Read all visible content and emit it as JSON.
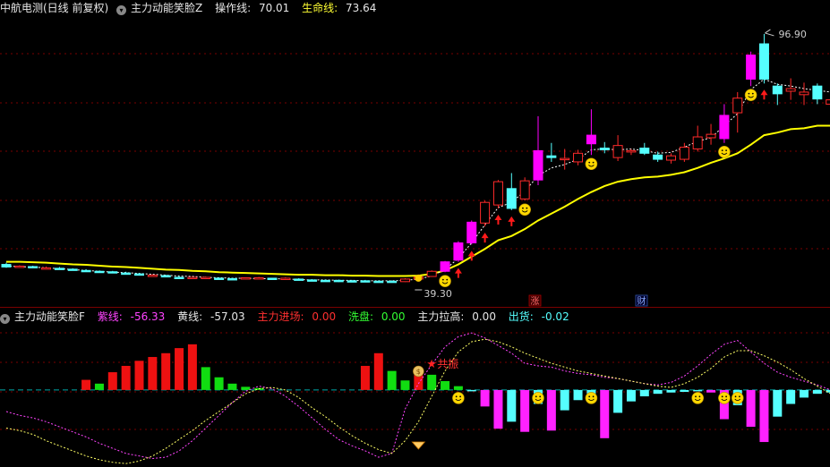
{
  "main_legend": {
    "stock": "中航电测(日线 前复权)",
    "indicator": "主力动能笑脸Z",
    "op_label": "操作线:",
    "op_value": "70.01",
    "life_label": "生命线:",
    "life_value": "73.64"
  },
  "sub_legend": {
    "indicator": "主力动能笑脸F",
    "purple_label": "紫线:",
    "purple_value": "-56.33",
    "yellow_label": "黄线:",
    "yellow_value": "-57.03",
    "inflow_label": "主力进场:",
    "inflow_value": "0.00",
    "wash_label": "洗盘:",
    "wash_value": "0.00",
    "lift_label": "主力拉高:",
    "lift_value": "0.00",
    "out_label": "出货:",
    "out_value": "-0.02"
  },
  "annotations": {
    "high_price": "96.90",
    "low_price": "39.30",
    "tag_rise": "涨",
    "tag_fin": "财",
    "resonance": "共振"
  },
  "colors": {
    "up": "#ff2a2a",
    "down": "#55ffff",
    "limit_up": "#ff00ff",
    "life_line": "#ffff00",
    "op_line": "#ffffff",
    "purple_line": "#ff44ff",
    "yellow_line": "#ffff66"
  },
  "chart_data": [
    {
      "type": "candlestick",
      "title": "中航电测(日线 前复权)",
      "ylim": [
        35,
        100
      ],
      "candles": [
        {
          "o": 43.4,
          "h": 43.8,
          "l": 42.6,
          "c": 42.8,
          "k": "down"
        },
        {
          "o": 43.0,
          "h": 43.2,
          "l": 42.7,
          "c": 43.0,
          "k": "up"
        },
        {
          "o": 42.9,
          "h": 43.1,
          "l": 42.5,
          "c": 42.7,
          "k": "down"
        },
        {
          "o": 42.6,
          "h": 42.9,
          "l": 42.4,
          "c": 42.6,
          "k": "up"
        },
        {
          "o": 42.5,
          "h": 42.8,
          "l": 42.2,
          "c": 42.3,
          "k": "down"
        },
        {
          "o": 42.3,
          "h": 42.5,
          "l": 42.0,
          "c": 42.2,
          "k": "down"
        },
        {
          "o": 42.0,
          "h": 42.3,
          "l": 41.8,
          "c": 41.9,
          "k": "down"
        },
        {
          "o": 41.8,
          "h": 42.0,
          "l": 41.5,
          "c": 41.6,
          "k": "down"
        },
        {
          "o": 41.7,
          "h": 41.9,
          "l": 41.4,
          "c": 41.5,
          "k": "down"
        },
        {
          "o": 41.4,
          "h": 41.7,
          "l": 41.1,
          "c": 41.2,
          "k": "down"
        },
        {
          "o": 41.2,
          "h": 41.4,
          "l": 40.9,
          "c": 41.0,
          "k": "down"
        },
        {
          "o": 40.9,
          "h": 41.1,
          "l": 40.6,
          "c": 40.8,
          "k": "up"
        },
        {
          "o": 40.8,
          "h": 41.0,
          "l": 40.4,
          "c": 40.5,
          "k": "down"
        },
        {
          "o": 40.4,
          "h": 40.7,
          "l": 40.2,
          "c": 40.3,
          "k": "down"
        },
        {
          "o": 40.3,
          "h": 40.6,
          "l": 40.1,
          "c": 40.4,
          "k": "up"
        },
        {
          "o": 40.4,
          "h": 40.6,
          "l": 40.0,
          "c": 40.2,
          "k": "up"
        },
        {
          "o": 40.2,
          "h": 40.4,
          "l": 39.9,
          "c": 40.0,
          "k": "down"
        },
        {
          "o": 40.0,
          "h": 40.3,
          "l": 39.8,
          "c": 40.1,
          "k": "down"
        },
        {
          "o": 40.1,
          "h": 40.4,
          "l": 39.9,
          "c": 40.3,
          "k": "up"
        },
        {
          "o": 40.3,
          "h": 40.5,
          "l": 40.0,
          "c": 40.1,
          "k": "up"
        },
        {
          "o": 40.1,
          "h": 40.3,
          "l": 39.9,
          "c": 40.2,
          "k": "down"
        },
        {
          "o": 40.2,
          "h": 40.4,
          "l": 39.8,
          "c": 40.0,
          "k": "up"
        },
        {
          "o": 40.0,
          "h": 40.2,
          "l": 39.7,
          "c": 39.8,
          "k": "down"
        },
        {
          "o": 39.8,
          "h": 40.0,
          "l": 39.5,
          "c": 39.6,
          "k": "down"
        },
        {
          "o": 39.6,
          "h": 39.9,
          "l": 39.4,
          "c": 39.7,
          "k": "down"
        },
        {
          "o": 39.7,
          "h": 39.9,
          "l": 39.3,
          "c": 39.5,
          "k": "down"
        },
        {
          "o": 39.5,
          "h": 39.8,
          "l": 39.3,
          "c": 39.6,
          "k": "down"
        },
        {
          "o": 39.6,
          "h": 39.8,
          "l": 39.3,
          "c": 39.4,
          "k": "down"
        },
        {
          "o": 39.4,
          "h": 39.7,
          "l": 39.3,
          "c": 39.5,
          "k": "down"
        },
        {
          "o": 39.5,
          "h": 39.7,
          "l": 39.3,
          "c": 39.4,
          "k": "down"
        },
        {
          "o": 39.4,
          "h": 40.2,
          "l": 39.3,
          "c": 40.0,
          "k": "up"
        },
        {
          "o": 40.0,
          "h": 40.6,
          "l": 39.8,
          "c": 40.5,
          "k": "up"
        },
        {
          "o": 40.6,
          "h": 42.0,
          "l": 40.5,
          "c": 41.8,
          "k": "up"
        },
        {
          "o": 41.8,
          "h": 44.2,
          "l": 41.6,
          "c": 44.0,
          "k": "limit"
        },
        {
          "o": 44.4,
          "h": 48.8,
          "l": 44.0,
          "c": 48.4,
          "k": "limit"
        },
        {
          "o": 48.4,
          "h": 53.6,
          "l": 48.0,
          "c": 53.2,
          "k": "limit"
        },
        {
          "o": 53.0,
          "h": 58.2,
          "l": 52.2,
          "c": 57.8,
          "k": "up"
        },
        {
          "o": 57.2,
          "h": 63.0,
          "l": 56.4,
          "c": 62.6,
          "k": "up"
        },
        {
          "o": 61.0,
          "h": 64.6,
          "l": 56.0,
          "c": 56.4,
          "k": "down"
        },
        {
          "o": 58.6,
          "h": 63.6,
          "l": 58.2,
          "c": 62.8,
          "k": "up"
        },
        {
          "o": 63.0,
          "h": 77.8,
          "l": 61.8,
          "c": 69.8,
          "k": "limit"
        },
        {
          "o": 68.6,
          "h": 71.6,
          "l": 67.2,
          "c": 68.2,
          "k": "down"
        },
        {
          "o": 68.0,
          "h": 70.2,
          "l": 65.4,
          "c": 67.8,
          "k": "up"
        },
        {
          "o": 67.2,
          "h": 70.0,
          "l": 66.4,
          "c": 69.2,
          "k": "up"
        },
        {
          "o": 71.4,
          "h": 79.4,
          "l": 68.8,
          "c": 73.4,
          "k": "limit"
        },
        {
          "o": 70.4,
          "h": 71.8,
          "l": 69.2,
          "c": 70.0,
          "k": "down"
        },
        {
          "o": 71.0,
          "h": 73.4,
          "l": 67.4,
          "c": 68.2,
          "k": "up"
        },
        {
          "o": 69.6,
          "h": 70.2,
          "l": 68.8,
          "c": 69.8,
          "k": "up"
        },
        {
          "o": 70.4,
          "h": 71.6,
          "l": 68.8,
          "c": 69.2,
          "k": "down"
        },
        {
          "o": 68.8,
          "h": 69.6,
          "l": 67.2,
          "c": 67.8,
          "k": "down"
        },
        {
          "o": 67.6,
          "h": 69.2,
          "l": 66.8,
          "c": 68.6,
          "k": "up"
        },
        {
          "o": 67.8,
          "h": 71.6,
          "l": 67.2,
          "c": 70.6,
          "k": "up"
        },
        {
          "o": 70.2,
          "h": 75.6,
          "l": 69.6,
          "c": 73.0,
          "k": "up"
        },
        {
          "o": 72.8,
          "h": 76.0,
          "l": 71.2,
          "c": 73.6,
          "k": "up"
        },
        {
          "o": 72.6,
          "h": 80.6,
          "l": 71.6,
          "c": 78.0,
          "k": "limit"
        },
        {
          "o": 78.6,
          "h": 83.4,
          "l": 74.0,
          "c": 82.0,
          "k": "up"
        },
        {
          "o": 86.4,
          "h": 92.8,
          "l": 84.8,
          "c": 92.0,
          "k": "limit"
        },
        {
          "o": 94.6,
          "h": 96.9,
          "l": 85.4,
          "c": 86.4,
          "k": "down"
        },
        {
          "o": 84.8,
          "h": 85.4,
          "l": 80.4,
          "c": 83.0,
          "k": "down"
        },
        {
          "o": 83.6,
          "h": 86.6,
          "l": 81.6,
          "c": 84.2,
          "k": "up"
        },
        {
          "o": 83.4,
          "h": 85.6,
          "l": 80.4,
          "c": 82.8,
          "k": "up"
        },
        {
          "o": 84.8,
          "h": 85.4,
          "l": 80.6,
          "c": 81.8,
          "k": "down"
        },
        {
          "o": 81.6,
          "h": 83.6,
          "l": 78.6,
          "c": 80.6,
          "k": "up"
        }
      ],
      "life_line": [
        44.0,
        44.0,
        43.9,
        43.8,
        43.6,
        43.4,
        43.3,
        43.1,
        42.9,
        42.8,
        42.6,
        42.4,
        42.2,
        42.1,
        41.9,
        41.8,
        41.6,
        41.5,
        41.4,
        41.3,
        41.2,
        41.1,
        41.0,
        41.0,
        40.9,
        40.9,
        40.8,
        40.8,
        40.7,
        40.7,
        40.7,
        40.8,
        41.2,
        42.0,
        43.4,
        45.2,
        47.0,
        49.0,
        50.0,
        51.6,
        53.6,
        55.2,
        56.8,
        58.6,
        60.2,
        61.6,
        62.6,
        63.2,
        63.6,
        63.8,
        64.2,
        64.8,
        65.8,
        67.0,
        68.0,
        69.2,
        71.2,
        73.4,
        74.0,
        74.8,
        75.0,
        75.6,
        75.6
      ],
      "op_line": [
        43.0,
        42.9,
        42.8,
        42.6,
        42.4,
        42.2,
        42.0,
        41.8,
        41.6,
        41.5,
        41.3,
        41.1,
        40.9,
        40.7,
        40.6,
        40.4,
        40.3,
        40.2,
        40.2,
        40.1,
        40.1,
        40.0,
        39.9,
        39.8,
        39.8,
        39.7,
        39.7,
        39.6,
        39.6,
        39.6,
        39.7,
        40.0,
        40.7,
        42.2,
        44.8,
        48.4,
        52.6,
        56.6,
        57.8,
        60.4,
        64.0,
        65.8,
        66.6,
        67.8,
        70.0,
        70.2,
        70.0,
        70.2,
        69.8,
        69.2,
        69.4,
        70.6,
        72.0,
        72.8,
        75.6,
        78.4,
        84.0,
        86.4,
        85.2,
        84.8,
        84.2,
        83.8,
        83.4
      ],
      "marks": {
        "up_arrows": [
          34,
          35,
          36,
          37,
          38,
          57
        ],
        "smileys": [
          33,
          39,
          44,
          54,
          56
        ],
        "money_bag": 31
      },
      "annotations": [
        "96.90",
        "39.30",
        "涨",
        "财"
      ]
    },
    {
      "type": "bar_and_line",
      "title": "主力动能笑脸F",
      "ylim": [
        -120,
        100
      ],
      "hist": [
        {
          "i": 6,
          "v": 16,
          "c": "r"
        },
        {
          "i": 7,
          "v": 10,
          "c": "g"
        },
        {
          "i": 8,
          "v": 28,
          "c": "r"
        },
        {
          "i": 9,
          "v": 38,
          "c": "r"
        },
        {
          "i": 10,
          "v": 46,
          "c": "r"
        },
        {
          "i": 11,
          "v": 52,
          "c": "r"
        },
        {
          "i": 12,
          "v": 58,
          "c": "r"
        },
        {
          "i": 13,
          "v": 66,
          "c": "r"
        },
        {
          "i": 14,
          "v": 72,
          "c": "r"
        },
        {
          "i": 15,
          "v": 36,
          "c": "g"
        },
        {
          "i": 16,
          "v": 20,
          "c": "g"
        },
        {
          "i": 17,
          "v": 10,
          "c": "g"
        },
        {
          "i": 18,
          "v": 5,
          "c": "g"
        },
        {
          "i": 19,
          "v": 3,
          "c": "g"
        },
        {
          "i": 27,
          "v": 38,
          "c": "r"
        },
        {
          "i": 28,
          "v": 58,
          "c": "r"
        },
        {
          "i": 29,
          "v": 30,
          "c": "g"
        },
        {
          "i": 30,
          "v": 15,
          "c": "g"
        },
        {
          "i": 31,
          "v": 24,
          "c": "r"
        },
        {
          "i": 32,
          "v": 24,
          "c": "g"
        },
        {
          "i": 33,
          "v": 14,
          "c": "g"
        },
        {
          "i": 34,
          "v": 6,
          "c": "g"
        },
        {
          "i": 35,
          "v": -2,
          "c": "c"
        },
        {
          "i": 36,
          "v": -26,
          "c": "m"
        },
        {
          "i": 37,
          "v": -61,
          "c": "m"
        },
        {
          "i": 38,
          "v": -50,
          "c": "c"
        },
        {
          "i": 39,
          "v": -66,
          "c": "m"
        },
        {
          "i": 40,
          "v": -22,
          "c": "c"
        },
        {
          "i": 41,
          "v": -64,
          "c": "m"
        },
        {
          "i": 42,
          "v": -32,
          "c": "c"
        },
        {
          "i": 43,
          "v": -16,
          "c": "c"
        },
        {
          "i": 44,
          "v": -12,
          "c": "c"
        },
        {
          "i": 45,
          "v": -76,
          "c": "m"
        },
        {
          "i": 46,
          "v": -36,
          "c": "c"
        },
        {
          "i": 47,
          "v": -18,
          "c": "c"
        },
        {
          "i": 48,
          "v": -10,
          "c": "c"
        },
        {
          "i": 49,
          "v": -6,
          "c": "c"
        },
        {
          "i": 50,
          "v": -4,
          "c": "c"
        },
        {
          "i": 51,
          "v": -3,
          "c": "c"
        },
        {
          "i": 52,
          "v": -2,
          "c": "c"
        },
        {
          "i": 53,
          "v": -4,
          "c": "m"
        },
        {
          "i": 54,
          "v": -46,
          "c": "m"
        },
        {
          "i": 55,
          "v": -24,
          "c": "c"
        },
        {
          "i": 56,
          "v": -58,
          "c": "m"
        },
        {
          "i": 57,
          "v": -82,
          "c": "m"
        },
        {
          "i": 58,
          "v": -42,
          "c": "c"
        },
        {
          "i": 59,
          "v": -22,
          "c": "c"
        },
        {
          "i": 60,
          "v": -12,
          "c": "c"
        },
        {
          "i": 61,
          "v": -6,
          "c": "c"
        },
        {
          "i": 62,
          "v": -4,
          "c": "c"
        }
      ],
      "purple_line": [
        -34,
        -40,
        -44,
        -50,
        -58,
        -66,
        -74,
        -84,
        -92,
        -100,
        -104,
        -108,
        -106,
        -96,
        -80,
        -60,
        -40,
        -20,
        -2,
        6,
        2,
        -10,
        -26,
        -44,
        -62,
        -78,
        -88,
        -96,
        -106,
        -100,
        -30,
        10,
        40,
        68,
        84,
        90,
        82,
        70,
        58,
        42,
        38,
        36,
        30,
        26,
        24,
        20,
        18,
        14,
        10,
        8,
        12,
        22,
        38,
        56,
        72,
        78,
        60,
        42,
        28,
        20,
        14,
        8,
        0
      ],
      "yellow_line": [
        -60,
        -64,
        -70,
        -80,
        -88,
        -96,
        -104,
        -110,
        -114,
        -116,
        -112,
        -104,
        -92,
        -78,
        -64,
        -48,
        -34,
        -20,
        -6,
        2,
        4,
        0,
        -12,
        -28,
        -42,
        -58,
        -72,
        -84,
        -94,
        -100,
        -80,
        -50,
        -10,
        30,
        60,
        76,
        80,
        76,
        68,
        58,
        50,
        42,
        36,
        30,
        26,
        22,
        18,
        14,
        10,
        6,
        4,
        10,
        20,
        34,
        52,
        62,
        62,
        54,
        44,
        32,
        18,
        6,
        -6
      ],
      "marks": {
        "smileys": [
          34,
          40,
          44,
          52,
          54,
          55
        ],
        "diamond": 31,
        "money_bag": 31,
        "star_label": "共振"
      }
    }
  ]
}
